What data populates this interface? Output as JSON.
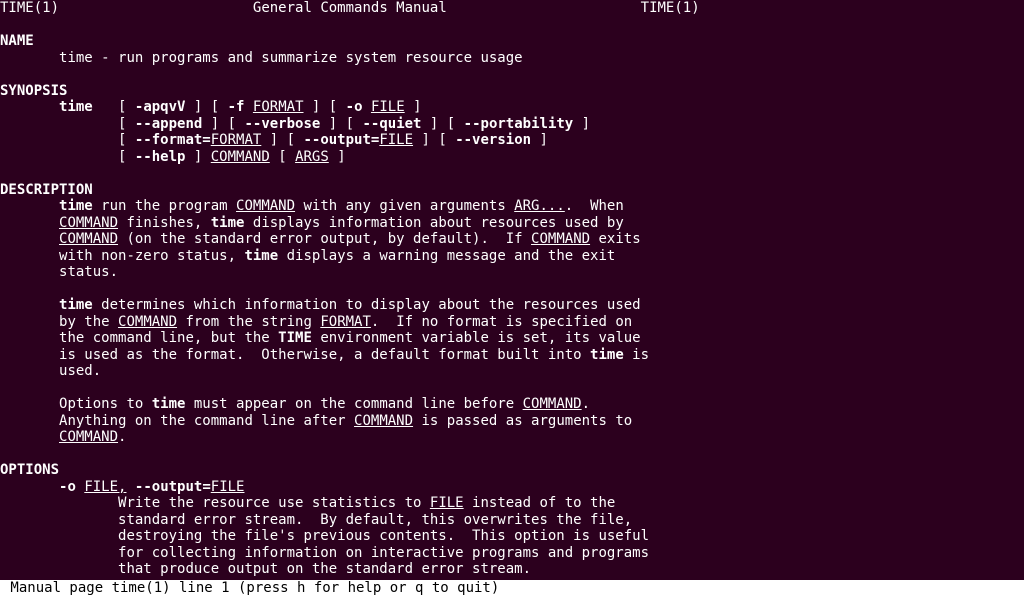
{
  "header": {
    "left": "TIME(1)",
    "center": "General Commands Manual",
    "right": "TIME(1)"
  },
  "sections": {
    "name_hdr": "NAME",
    "name_body": "time - run programs and summarize system resource usage",
    "synopsis_hdr": "SYNOPSIS",
    "syn": {
      "cmd": "time",
      "l1_a": "   [ ",
      "l1_b": "-apqvV",
      "l1_c": " ] [ ",
      "l1_d": "-f",
      "l1_e": " ",
      "l1_f": "FORMAT",
      "l1_g": " ] [ ",
      "l1_h": "-o",
      "l1_i": " ",
      "l1_j": "FILE",
      "l1_k": " ]",
      "l2_a": "[ ",
      "l2_b": "--append",
      "l2_c": " ] [ ",
      "l2_d": "--verbose",
      "l2_e": " ] [ ",
      "l2_f": "--quiet",
      "l2_g": " ] [ ",
      "l2_h": "--portability",
      "l2_i": " ]",
      "l3_a": "[ ",
      "l3_b": "--format=",
      "l3_c": "FORMAT",
      "l3_d": " ] [ ",
      "l3_e": "--output=",
      "l3_f": "FILE",
      "l3_g": " ] [ ",
      "l3_h": "--version",
      "l3_i": " ]",
      "l4_a": "[ ",
      "l4_b": "--help",
      "l4_c": " ] ",
      "l4_d": "COMMAND",
      "l4_e": " [ ",
      "l4_f": "ARGS",
      "l4_g": " ]"
    },
    "description_hdr": "DESCRIPTION",
    "desc": {
      "p1_a": "time",
      "p1_b": " run the program ",
      "p1_c": "COMMAND",
      "p1_d": " with any given arguments ",
      "p1_e": "ARG...",
      "p1_f": ".  When",
      "p2_a": "COMMAND",
      "p2_b": " finishes, ",
      "p2_c": "time",
      "p2_d": " displays information about resources used by",
      "p3_a": "COMMAND",
      "p3_b": " (on the standard error output, by default).  If ",
      "p3_c": "COMMAND",
      "p3_d": " exits",
      "p4_a": "with non-zero status, ",
      "p4_b": "time",
      "p4_c": " displays a warning message and the exit",
      "p5": "status.",
      "p6_a": "time",
      "p6_b": " determines which information to display about the resources used",
      "p7_a": "by the ",
      "p7_b": "COMMAND",
      "p7_c": " from the string ",
      "p7_d": "FORMAT",
      "p7_e": ".  If no format is specified on",
      "p8_a": "the command line, but the ",
      "p8_b": "TIME",
      "p8_c": " environment variable is set, its value",
      "p9_a": "is used as the format.  Otherwise, a default format built into ",
      "p9_b": "time",
      "p9_c": " is",
      "p10": "used.",
      "p11_a": "Options to ",
      "p11_b": "time",
      "p11_c": " must appear on the command line before ",
      "p11_d": "COMMAND",
      "p11_e": ".",
      "p12_a": "Anything on the command line after ",
      "p12_b": "COMMAND",
      "p12_c": " is passed as arguments to",
      "p13_a": "COMMAND",
      "p13_b": "."
    },
    "options_hdr": "OPTIONS",
    "opt": {
      "h_a": "-o",
      "h_b": " ",
      "h_c": "FILE,",
      "h_d": " ",
      "h_e": "--output=",
      "h_f": "FILE",
      "l1_a": "Write the resource use statistics to ",
      "l1_b": "FILE",
      "l1_c": " instead of to the",
      "l2": "standard error stream.  By default, this overwrites the file,",
      "l3": "destroying the file's previous contents.  This option is useful",
      "l4": "for collecting information on interactive programs and programs",
      "l5": "that produce output on the standard error stream."
    }
  },
  "status_line": " Manual page time(1) line 1 (press h for help or q to quit)"
}
